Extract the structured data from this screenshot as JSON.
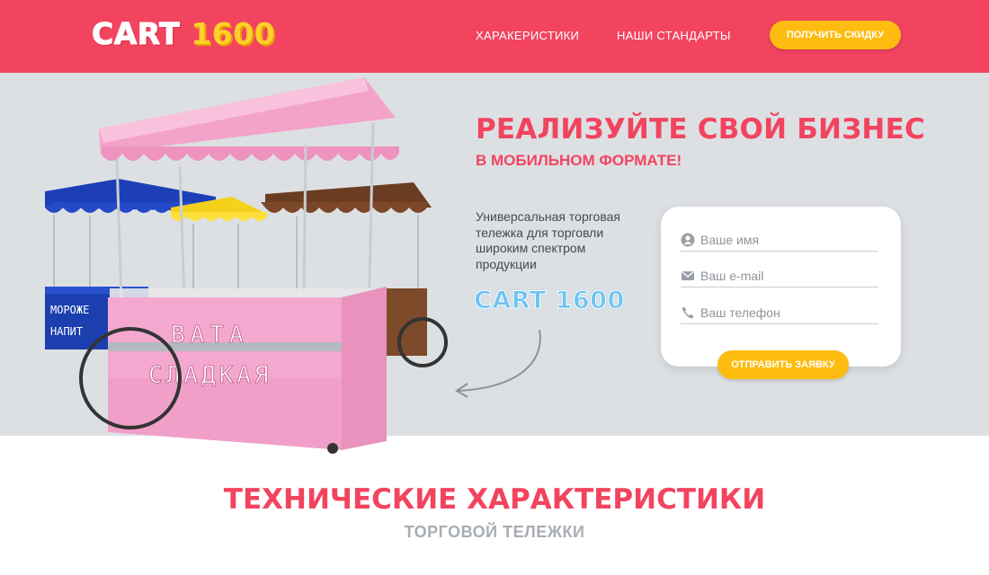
{
  "header": {
    "logo_word1": "CART",
    "logo_word2": "1600",
    "nav": [
      "ХАРАКЕРИСТИКИ",
      "НАШИ СТАНДАРТЫ"
    ],
    "discount_button": "ПОЛУЧИТЬ СКИДКУ"
  },
  "hero": {
    "title": "РЕАЛИЗУЙТЕ СВОЙ БИЗНЕС",
    "subtitle": "В МОБИЛЬНОМ ФОРМАТЕ!",
    "description": "Универсальная торговая тележка для торговли широким спектром продукции",
    "logo": "CART 1600",
    "cart_sign_line1": "ВАТА",
    "cart_sign_line2": "СЛАДКАЯ",
    "cart_sign_blue1": "МОРОЖЕ",
    "cart_sign_blue2": "НАПИТ"
  },
  "form": {
    "name_placeholder": "Ваше имя",
    "email_placeholder": "Ваш e-mail",
    "phone_placeholder": "Ваш телефон",
    "submit_button": "ОТПРАВИТЬ ЗАЯВКУ"
  },
  "section": {
    "title": "ТЕХНИЧЕСКИЕ ХАРАКТЕРИСТИКИ",
    "subtitle": "ТОРГОВОЙ ТЕЛЕЖКИ"
  },
  "colors": {
    "brand_red": "#f2445f",
    "accent_yellow": "#fdbc0f",
    "hero_bg": "#dde0e3",
    "logo_blue": "#6fc3ef",
    "cart_pink": "#f4a8cf"
  },
  "icons": [
    "user-icon",
    "envelope-icon",
    "phone-icon",
    "curved-arrow-icon"
  ]
}
